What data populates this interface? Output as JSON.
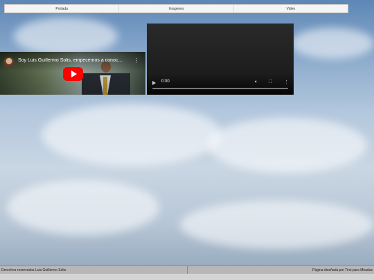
{
  "nav": {
    "items": [
      "Portada",
      "Imagenes",
      "Video"
    ]
  },
  "youtube": {
    "title": "Soy Luis Guillermo Solis, empecemos a conoc...",
    "kebab": "⋮"
  },
  "video_player": {
    "time": "0:00",
    "icons": {
      "mute": "mute-icon",
      "fullscreen": "fullscreen-icon",
      "more": "more-icon"
    }
  },
  "footer": {
    "left": "Derechos reservados Luis Guillermo Solis",
    "right": "Página diseñada por Tirsi para Miradas"
  }
}
